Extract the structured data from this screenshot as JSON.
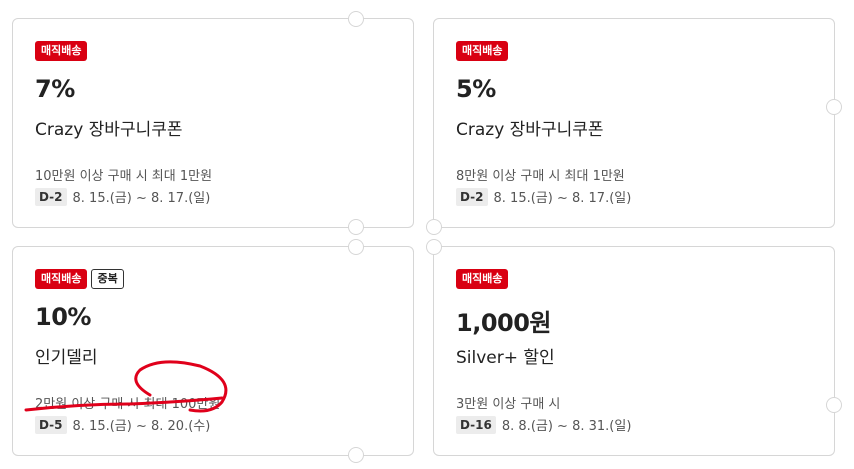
{
  "coupons": [
    {
      "badges": [
        "매직배송"
      ],
      "discount": "7%",
      "name": "Crazy 장바구니쿠폰",
      "condition": "10만원 이상 구매 시 최대 1만원",
      "dday": "D-2",
      "period": "8. 15.(금) ~ 8. 17.(일)"
    },
    {
      "badges": [
        "매직배송"
      ],
      "discount": "5%",
      "name": "Crazy 장바구니쿠폰",
      "condition": "8만원 이상 구매 시 최대 1만원",
      "dday": "D-2",
      "period": "8. 15.(금) ~ 8. 17.(일)"
    },
    {
      "badges": [
        "매직배송"
      ],
      "tag": "중복",
      "discount": "10%",
      "name": "인기델리",
      "condition": "2만원 이상 구매 시 최대 100만원",
      "dday": "D-5",
      "period": "8. 15.(금) ~ 8. 20.(수)"
    },
    {
      "badges": [
        "매직배송"
      ],
      "discount": "1,000원",
      "name": "Silver+ 할인",
      "condition": "3만원 이상 구매 시",
      "dday": "D-16",
      "period": "8. 8.(금) ~ 8. 31.(일)"
    }
  ],
  "colors": {
    "badge_red": "#d90012",
    "annotation_red": "#e0001b"
  }
}
